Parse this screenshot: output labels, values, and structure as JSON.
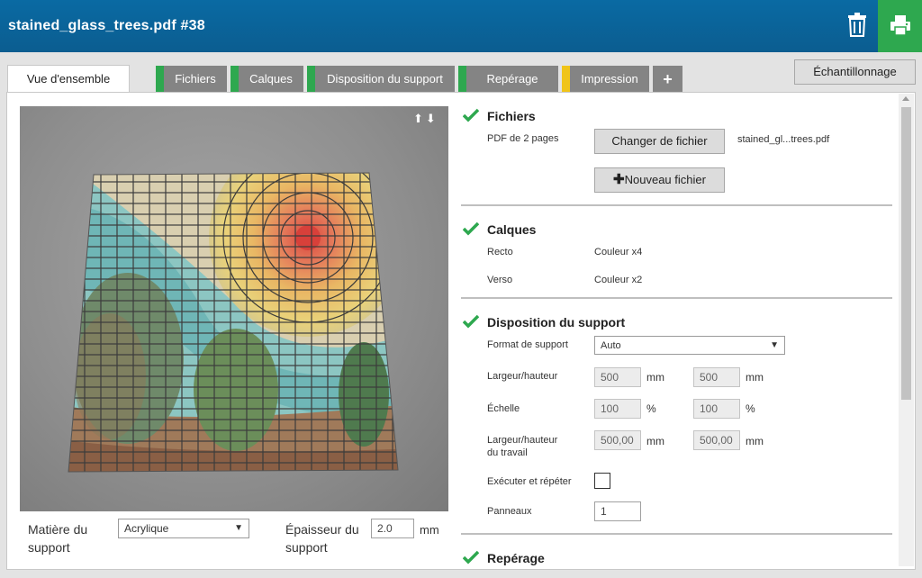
{
  "header": {
    "title": "stained_glass_trees.pdf #38"
  },
  "tabs": [
    {
      "label": "Vue d'ensemble",
      "color": ""
    },
    {
      "label": "Fichiers",
      "color": "#2ea84f"
    },
    {
      "label": "Calques",
      "color": "#2ea84f"
    },
    {
      "label": "Disposition du support",
      "color": "#2ea84f"
    },
    {
      "label": "Repérage",
      "color": "#2ea84f"
    },
    {
      "label": "Impression",
      "color": "#f0c419"
    },
    {
      "label": "+",
      "color": ""
    }
  ],
  "sample_button": "Échantillonnage",
  "preview": {
    "material_label_1": "Matière du",
    "material_label_2": "support",
    "material_value": "Acrylique",
    "thickness_label_1": "Épaisseur du",
    "thickness_label_2": "support",
    "thickness_value": "2.0",
    "thickness_unit": "mm"
  },
  "files": {
    "title": "Fichiers",
    "info": "PDF de 2 pages",
    "change_button": "Changer de fichier",
    "filename": "stained_gl...trees.pdf",
    "new_button": "Nouveau fichier"
  },
  "layers": {
    "title": "Calques",
    "front_label": "Recto",
    "front_value": "Couleur x4",
    "back_label": "Verso",
    "back_value": "Couleur x2"
  },
  "layout": {
    "title": "Disposition du support",
    "format_label": "Format de support",
    "format_value": "Auto",
    "size_label": "Largeur/hauteur",
    "width": "500",
    "height": "500",
    "mm": "mm",
    "scale_label": "Échelle",
    "scale_x": "100",
    "scale_y": "100",
    "percent": "%",
    "work_label_1": "Largeur/hauteur",
    "work_label_2": "du travail",
    "work_width": "500,00",
    "work_height": "500,00",
    "repeat_label": "Exécuter et répéter",
    "panels_label": "Panneaux",
    "panels_value": "1"
  },
  "registration": {
    "title": "Repérage"
  },
  "colors": {
    "header": "#0b5d90",
    "print": "#2ea84f",
    "check": "#2ea84f"
  }
}
